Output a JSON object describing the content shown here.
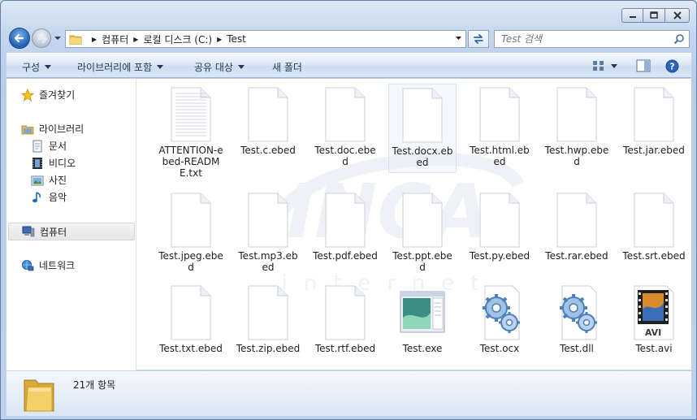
{
  "window": {
    "buttons": {
      "minimize": "minimize-icon",
      "maximize": "maximize-icon",
      "close": "close-icon"
    }
  },
  "address": {
    "crumbs": [
      "컴퓨터",
      "로컬 디스크 (C:)",
      "Test"
    ]
  },
  "search": {
    "placeholder": "Test 검색"
  },
  "toolbar": {
    "organize": "구성",
    "include_in_library": "라이브러리에 포함",
    "share_with": "공유 대상",
    "new_folder": "새 폴더"
  },
  "nav": {
    "favorites": "즐겨찾기",
    "libraries": "라이브러리",
    "documents": "문서",
    "videos": "비디오",
    "pictures": "사진",
    "music": "음악",
    "computer": "컴퓨터",
    "network": "네트워크"
  },
  "files": [
    {
      "name": "ATTENTION-ebed-README.txt",
      "type": "text-doc"
    },
    {
      "name": "Test.c.ebed",
      "type": "blank"
    },
    {
      "name": "Test.doc.ebed",
      "type": "blank"
    },
    {
      "name": "Test.docx.ebed",
      "type": "blank"
    },
    {
      "name": "Test.html.ebed",
      "type": "blank"
    },
    {
      "name": "Test.hwp.ebed",
      "type": "blank"
    },
    {
      "name": "Test.jar.ebed",
      "type": "blank"
    },
    {
      "name": "Test.jpeg.ebed",
      "type": "blank"
    },
    {
      "name": "Test.mp3.ebed",
      "type": "blank"
    },
    {
      "name": "Test.pdf.ebed",
      "type": "blank"
    },
    {
      "name": "Test.ppt.ebed",
      "type": "blank"
    },
    {
      "name": "Test.py.ebed",
      "type": "blank"
    },
    {
      "name": "Test.rar.ebed",
      "type": "blank"
    },
    {
      "name": "Test.srt.ebed",
      "type": "blank"
    },
    {
      "name": "Test.txt.ebed",
      "type": "blank"
    },
    {
      "name": "Test.zip.ebed",
      "type": "blank"
    },
    {
      "name": "Test.rtf.ebed",
      "type": "blank"
    },
    {
      "name": "Test.exe",
      "type": "exe"
    },
    {
      "name": "Test.ocx",
      "type": "gears"
    },
    {
      "name": "Test.dll",
      "type": "gears"
    },
    {
      "name": "Test.avi",
      "type": "video"
    }
  ],
  "status": {
    "item_count": "21개 항목"
  },
  "watermark": {
    "brand": "INCA",
    "sub": "internet"
  },
  "avi_label": "AVI"
}
